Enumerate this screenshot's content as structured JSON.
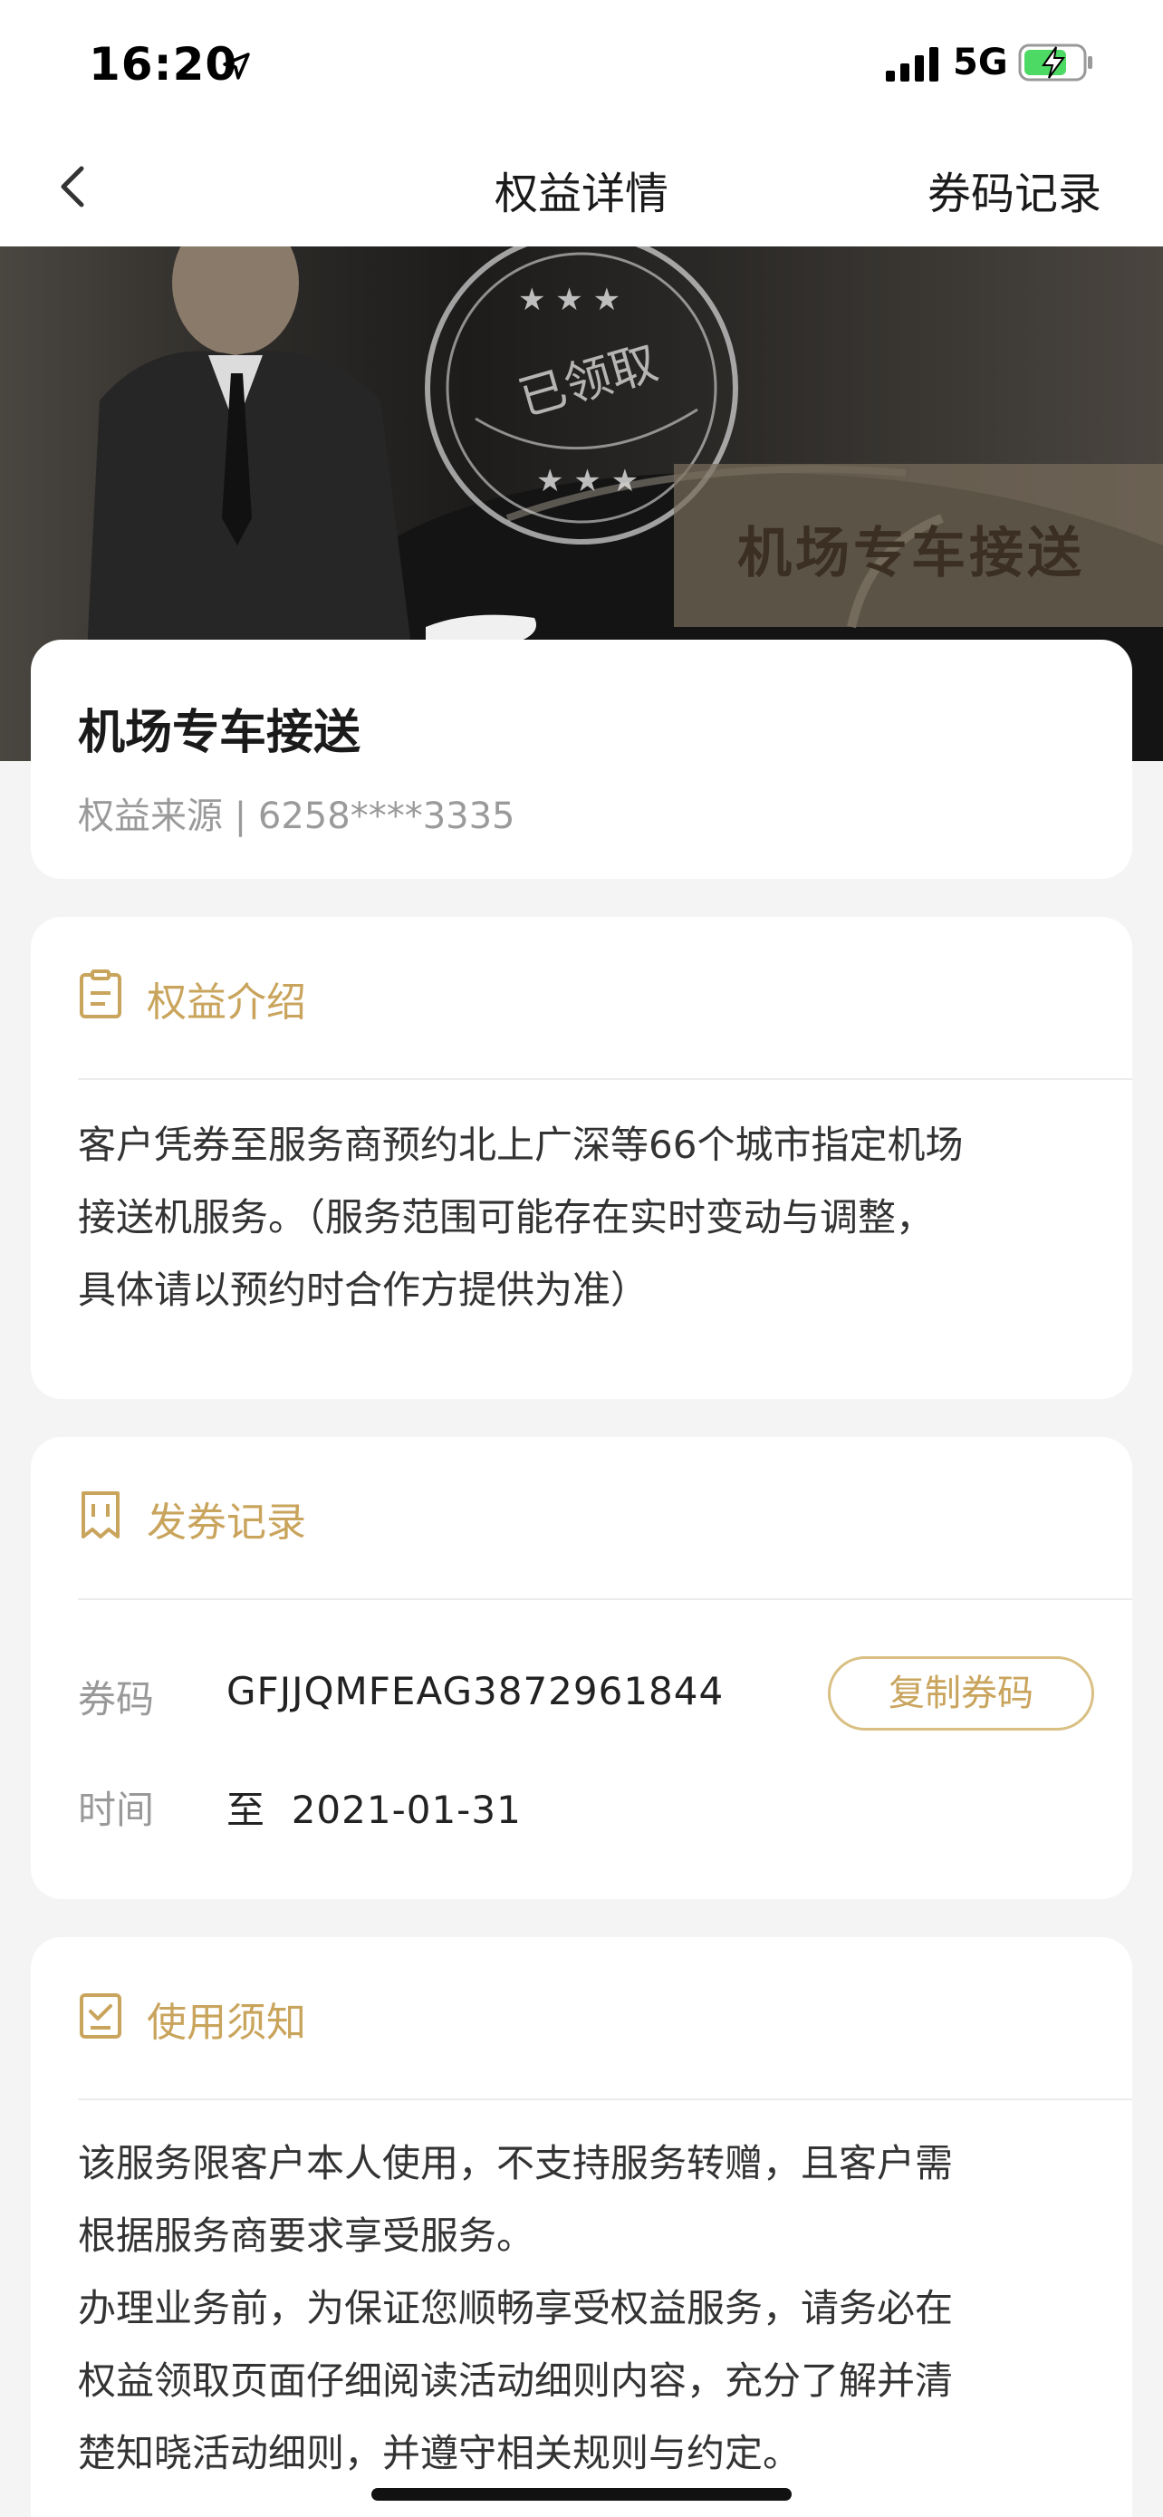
{
  "status_bar": {
    "time": "16:20",
    "network": "5G",
    "icons": [
      "location-arrow-icon",
      "signal-icon",
      "battery-charging-icon"
    ]
  },
  "nav": {
    "back_icon": "chevron-left-icon",
    "title": "权益详情",
    "right_link": "券码记录"
  },
  "hero": {
    "stamp_text": "已领取",
    "tag_text": "机场专车接送"
  },
  "summary": {
    "title": "机场专车接送",
    "source": "权益来源 | 6258****3335"
  },
  "intro": {
    "icon": "clipboard-icon",
    "heading": "权益介绍",
    "lines": [
      "客户凭券至服务商预约北上广深等66个城市指定机场",
      "接送机服务。（服务范围可能存在实时变动与调整，",
      "具体请以预约时合作方提供为准）"
    ]
  },
  "issue_record": {
    "icon": "ticket-icon",
    "heading": "发券记录",
    "code_label": "券码",
    "code_value": "GFJJQMFEAG3872961844",
    "copy_button": "复制券码",
    "time_label": "时间",
    "time_value": "至  2021-01-31"
  },
  "notice": {
    "icon": "checklist-icon",
    "heading": "使用须知",
    "lines": [
      "该服务限客户本人使用，不支持服务转赠，且客户需",
      "根据服务商要求享受服务。",
      "办理业务前，为保证您顺畅享受权益服务，请务必在",
      "权益领取页面仔细阅读活动细则内容，充分了解并清",
      "楚知晓活动细则，并遵守相关规则与约定。"
    ]
  },
  "colors": {
    "accent_gold": "#c9a45c",
    "page_bg": "#f4f4f4",
    "card_bg": "#ffffff"
  }
}
